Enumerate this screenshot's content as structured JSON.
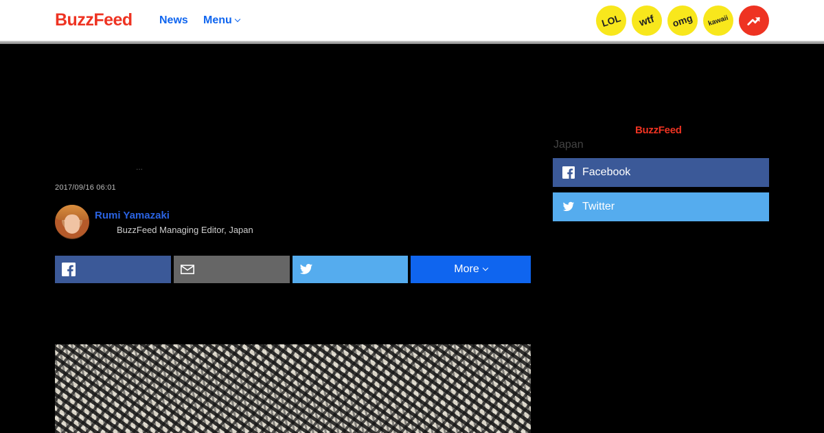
{
  "header": {
    "logo": "BuzzFeed",
    "nav": [
      {
        "label": "News"
      },
      {
        "label": "Menu"
      }
    ],
    "badges": [
      "LOL",
      "wtf",
      "omg",
      "kawaii"
    ],
    "trending_icon": "trending-arrow-icon"
  },
  "article": {
    "ellipsis": "...",
    "timestamp": "2017/09/16 06:01",
    "author": {
      "name": "Rumi Yamazaki",
      "title": "BuzzFeed Managing Editor, Japan"
    },
    "share": {
      "facebook_icon": "facebook-icon",
      "mail_icon": "mail-icon",
      "twitter_icon": "twitter-icon",
      "more_label": "More"
    }
  },
  "sidebar": {
    "logo": "BuzzFeed",
    "region": "Japan",
    "buttons": [
      {
        "label": "Facebook",
        "icon": "facebook-icon"
      },
      {
        "label": "Twitter",
        "icon": "twitter-icon"
      }
    ]
  },
  "colors": {
    "brand_red": "#ee3322",
    "link_blue": "#0f65ef",
    "facebook": "#3b5998",
    "twitter": "#55acee",
    "mail": "#666666",
    "badge_yellow": "#f8e71c"
  }
}
